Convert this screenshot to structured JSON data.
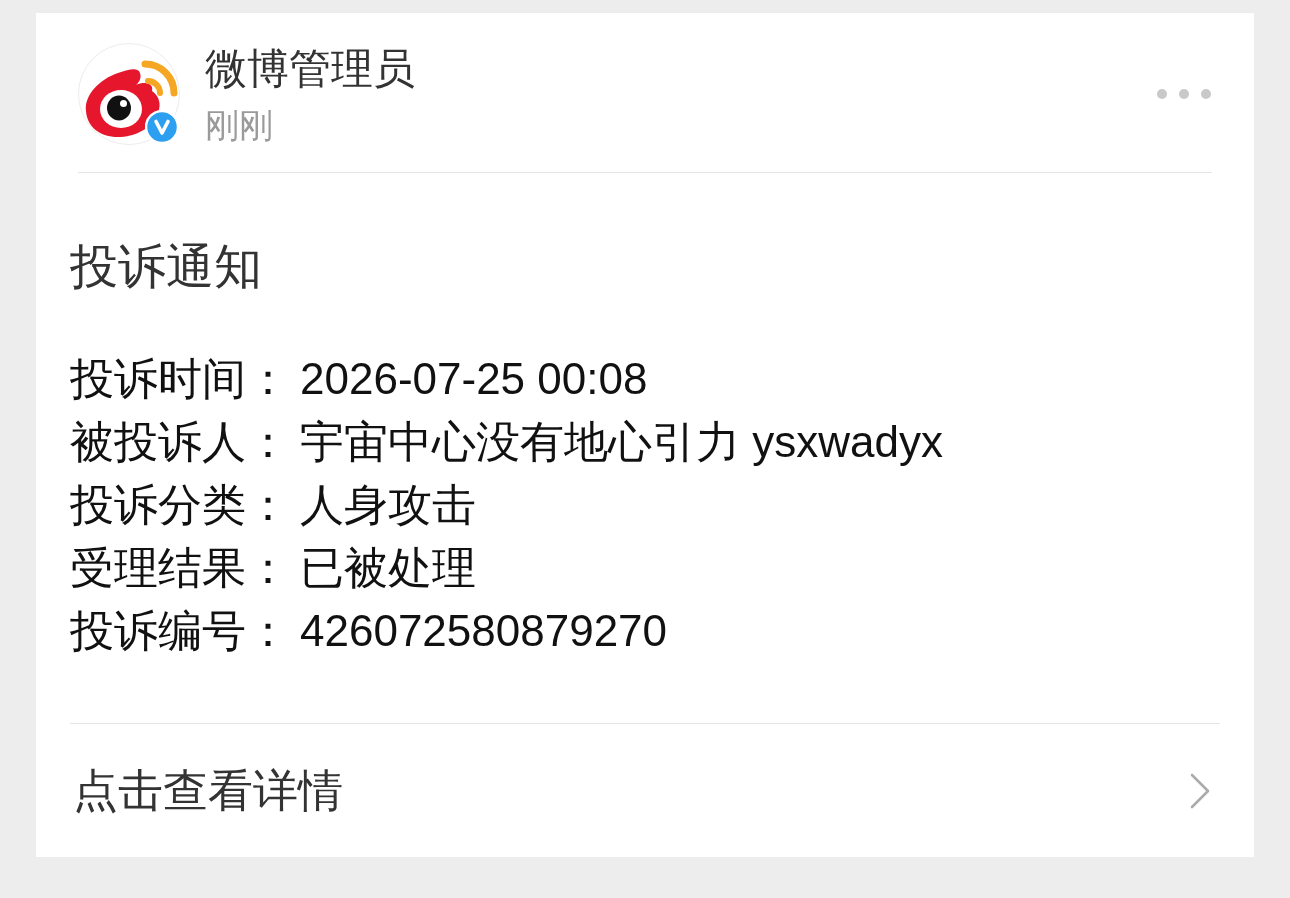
{
  "header": {
    "name": "微博管理员",
    "time": "刚刚",
    "verified": true
  },
  "notice": {
    "title": "投诉通知",
    "fields": [
      {
        "label": "投诉时间：",
        "value": "2026-07-25 00:08"
      },
      {
        "label": "被投诉人：",
        "value": "宇宙中心没有地心引力 ysxwadyx"
      },
      {
        "label": "投诉分类：",
        "value": "人身攻击"
      },
      {
        "label": "受理结果：",
        "value": "已被处理"
      },
      {
        "label": "投诉编号：",
        "value": "426072580879270"
      }
    ]
  },
  "footer": {
    "link": "点击查看详情"
  }
}
